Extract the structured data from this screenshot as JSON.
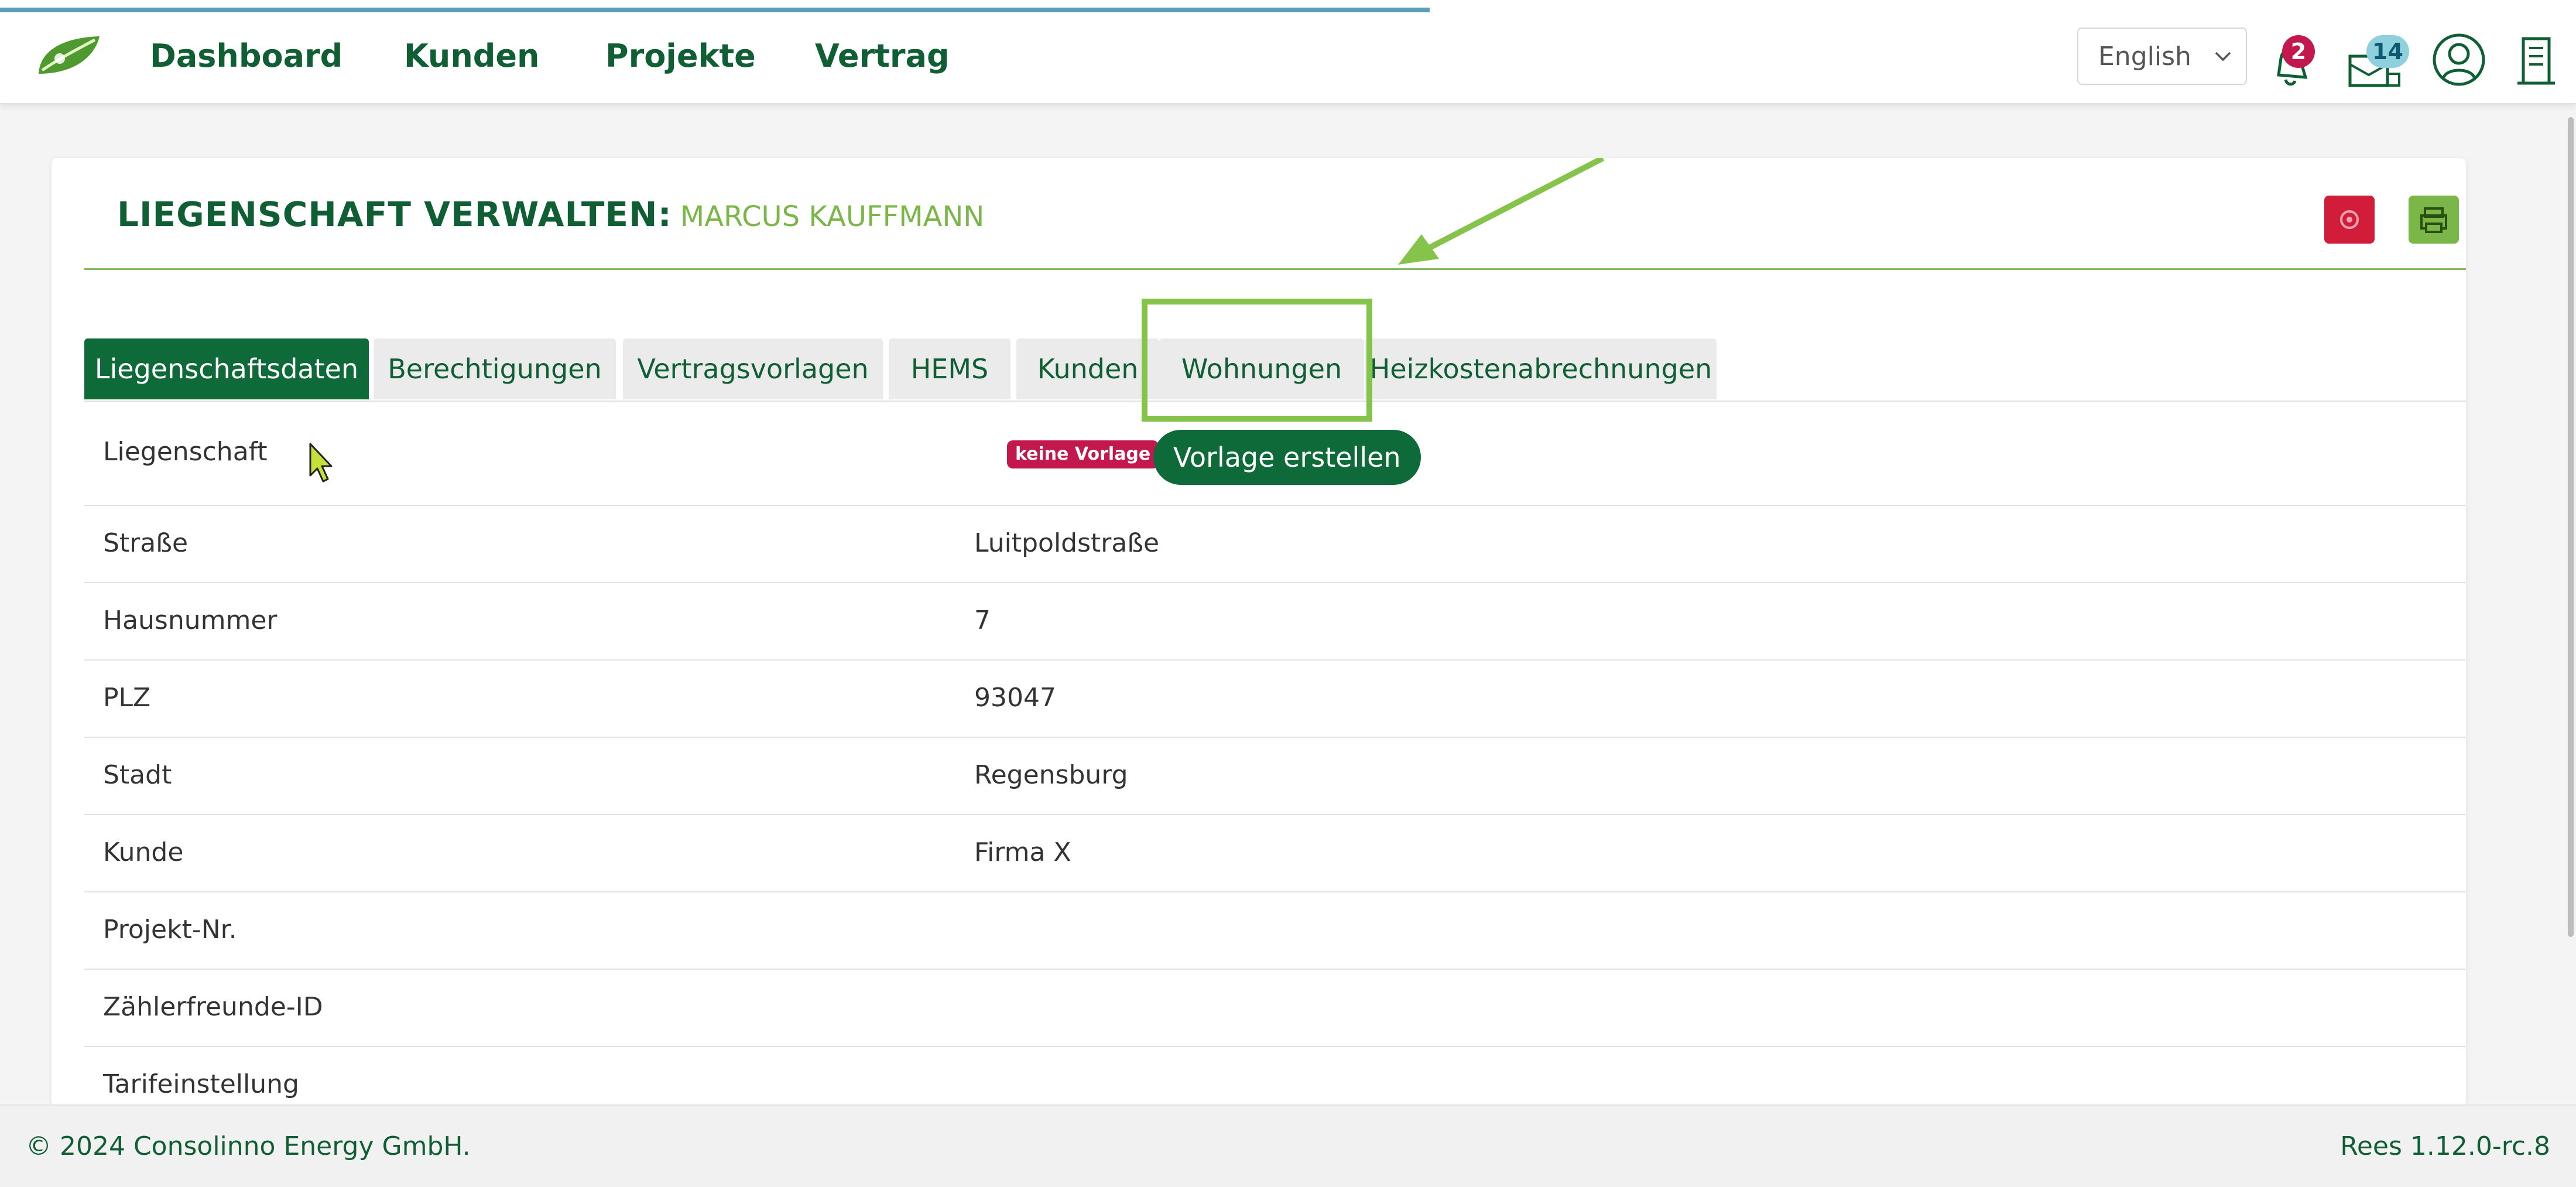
{
  "header": {
    "progress_fraction": 0.555,
    "nav": [
      {
        "label": "Dashboard"
      },
      {
        "label": "Kunden"
      },
      {
        "label": "Projekte"
      },
      {
        "label": "Vertrag"
      }
    ],
    "language": "English",
    "notifications_count": "2",
    "messages_count": "14",
    "icons": [
      "leaf-logo",
      "bell-icon",
      "message-icon",
      "user-icon",
      "building-icon",
      "chevron-down-icon"
    ]
  },
  "card": {
    "title": "LIEGENSCHAFT VERWALTEN:",
    "subtitle": "MARCUS KAUFFMANN",
    "actions": {
      "settings_icon": "gear-icon",
      "print_icon": "printer-icon"
    }
  },
  "tabs": [
    {
      "label": "Liegenschaftsdaten",
      "active": true
    },
    {
      "label": "Berechtigungen"
    },
    {
      "label": "Vertragsvorlagen"
    },
    {
      "label": "HEMS"
    },
    {
      "label": "Kunden"
    },
    {
      "label": "Wohnungen"
    },
    {
      "label": "Heizkostenabrechnungen"
    }
  ],
  "details": {
    "liegenschaft": {
      "label": "Liegenschaft",
      "badge": "keine Vorlage",
      "button": "Vorlage erstellen"
    },
    "rows": [
      {
        "label": "Straße",
        "value": "Luitpoldstraße"
      },
      {
        "label": "Hausnummer",
        "value": "7"
      },
      {
        "label": "PLZ",
        "value": "93047"
      },
      {
        "label": "Stadt",
        "value": "Regensburg"
      },
      {
        "label": "Kunde",
        "value": "Firma X"
      },
      {
        "label": "Projekt-Nr.",
        "value": ""
      },
      {
        "label": "Zählerfreunde-ID",
        "value": ""
      },
      {
        "label": "Tarifeinstellung",
        "value": ""
      }
    ]
  },
  "colors": {
    "brand_green": "#0f5e34",
    "accent_green": "#7ab648",
    "danger_red": "#d21d3a",
    "badge_red": "#c2184d",
    "highlight_green": "#86c34b"
  },
  "footer": {
    "copyright": "© 2024 Consolinno Energy GmbH.",
    "version": "Rees 1.12.0-rc.8"
  }
}
